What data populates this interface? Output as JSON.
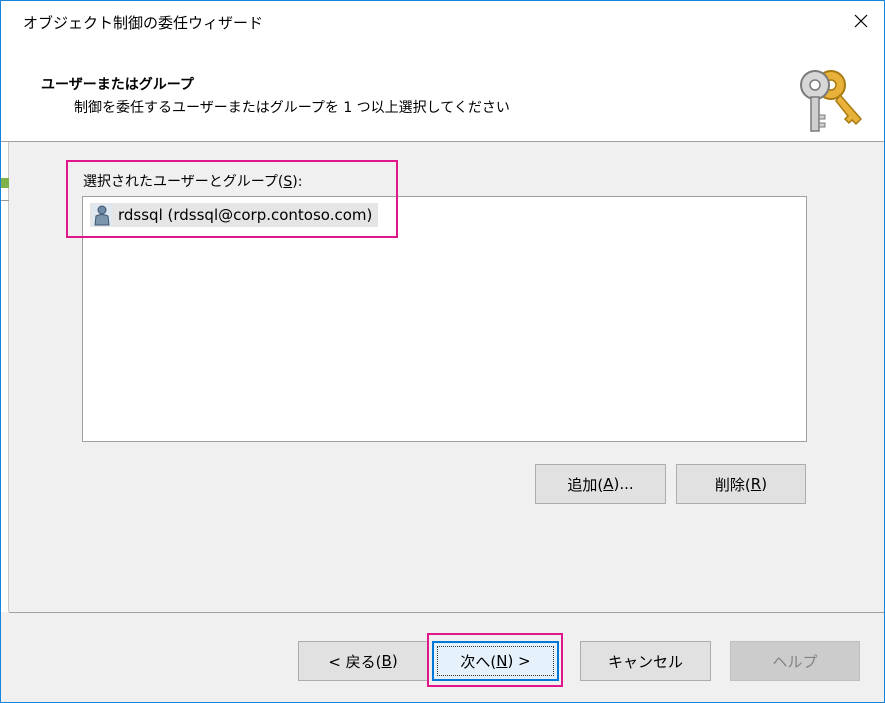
{
  "window": {
    "title": "オブジェクト制御の委任ウィザード"
  },
  "header": {
    "title": "ユーザーまたはグループ",
    "subtitle": "制御を委任するユーザーまたはグループを 1 つ以上選択してください",
    "icon": "keys-icon"
  },
  "main": {
    "group_label": "選択されたユーザーとグループ(",
    "group_label_accel": "S",
    "group_label_end": "):",
    "selected_items": [
      {
        "icon": "user-icon",
        "label": "rdssql (rdssql@corp.contoso.com)"
      }
    ],
    "add_button": {
      "prefix": "追加(",
      "accel": "A",
      "suffix": ")..."
    },
    "remove_button": {
      "prefix": "削除(",
      "accel": "R",
      "suffix": ")"
    }
  },
  "footer": {
    "back_button": {
      "prefix": "< 戻る(",
      "accel": "B",
      "suffix": ")"
    },
    "next_button": {
      "prefix": "次へ(",
      "accel": "N",
      "suffix": ") >"
    },
    "cancel_button": {
      "label": "キャンセル"
    },
    "help_button": {
      "label": "ヘルプ",
      "disabled": true
    }
  },
  "colors": {
    "highlight": "#e0168a",
    "accent": "#0078d7"
  }
}
